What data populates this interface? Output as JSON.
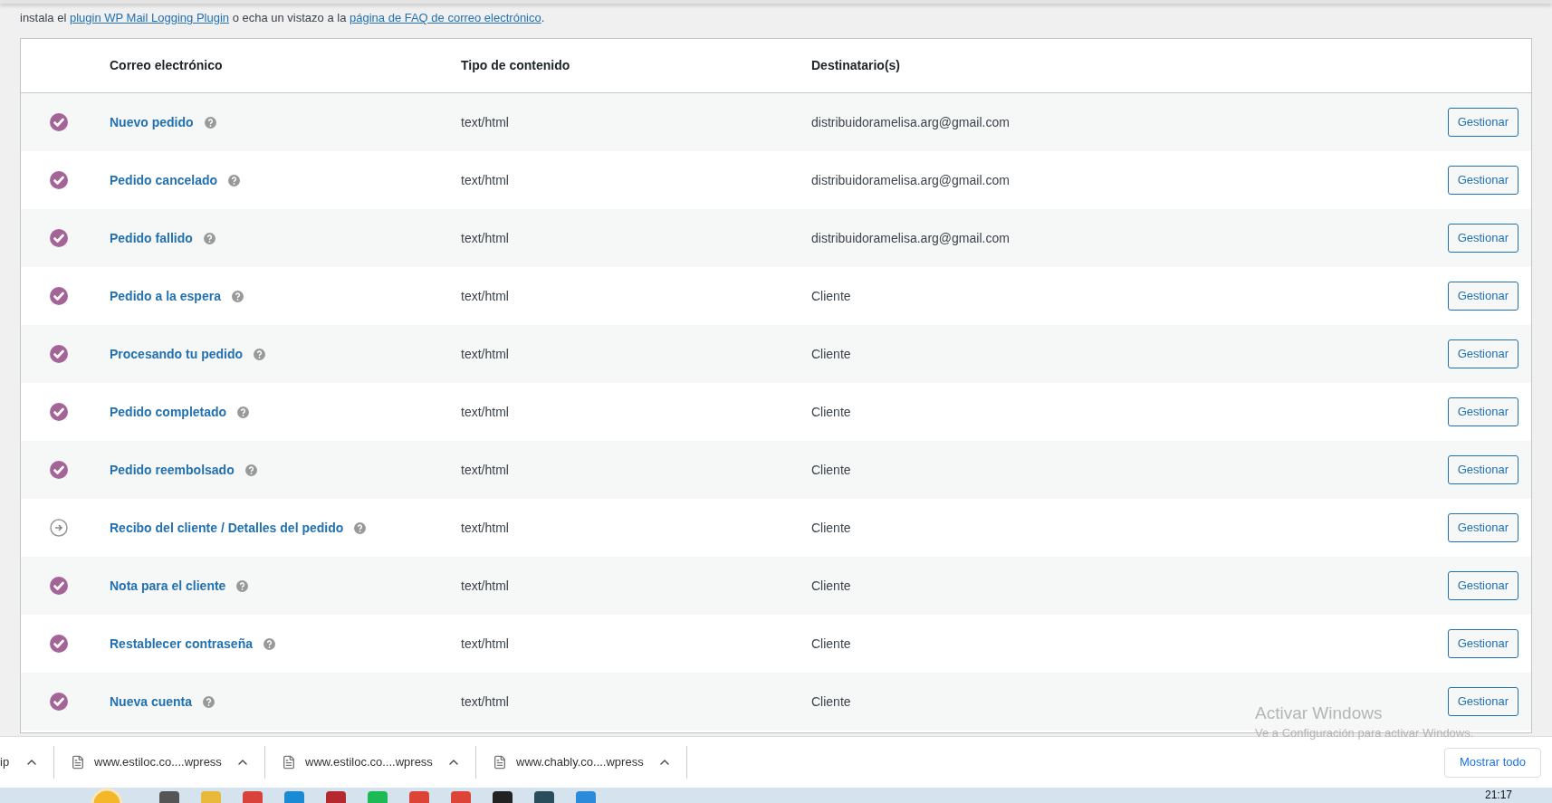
{
  "notice_parts": [
    {
      "kind": "text",
      "text": "instala el "
    },
    {
      "kind": "link",
      "text": "plugin WP Mail Logging Plugin"
    },
    {
      "kind": "text",
      "text": " o echa un vistazo a la "
    },
    {
      "kind": "link",
      "text": "página de FAQ de correo electrónico"
    },
    {
      "kind": "text",
      "text": "."
    }
  ],
  "table": {
    "columns": [
      "Correo electrónico",
      "Tipo de contenido",
      "Destinatario(s)"
    ],
    "rows": [
      {
        "enabled": true,
        "name": "Nuevo pedido",
        "type": "text/html",
        "recipient": "distribuidoramelisa.arg@gmail.com",
        "action": "Gestionar"
      },
      {
        "enabled": true,
        "name": "Pedido cancelado",
        "type": "text/html",
        "recipient": "distribuidoramelisa.arg@gmail.com",
        "action": "Gestionar"
      },
      {
        "enabled": true,
        "name": "Pedido fallido",
        "type": "text/html",
        "recipient": "distribuidoramelisa.arg@gmail.com",
        "action": "Gestionar"
      },
      {
        "enabled": true,
        "name": "Pedido a la espera",
        "type": "text/html",
        "recipient": "Cliente",
        "action": "Gestionar"
      },
      {
        "enabled": true,
        "name": "Procesando tu pedido",
        "type": "text/html",
        "recipient": "Cliente",
        "action": "Gestionar"
      },
      {
        "enabled": true,
        "name": "Pedido completado",
        "type": "text/html",
        "recipient": "Cliente",
        "action": "Gestionar"
      },
      {
        "enabled": true,
        "name": "Pedido reembolsado",
        "type": "text/html",
        "recipient": "Cliente",
        "action": "Gestionar"
      },
      {
        "enabled": false,
        "name": "Recibo del cliente / Detalles del pedido",
        "type": "text/html",
        "recipient": "Cliente",
        "action": "Gestionar"
      },
      {
        "enabled": true,
        "name": "Nota para el cliente",
        "type": "text/html",
        "recipient": "Cliente",
        "action": "Gestionar"
      },
      {
        "enabled": true,
        "name": "Restablecer contraseña",
        "type": "text/html",
        "recipient": "Cliente",
        "action": "Gestionar"
      },
      {
        "enabled": true,
        "name": "Nueva cuenta",
        "type": "text/html",
        "recipient": "Cliente",
        "action": "Gestionar"
      }
    ]
  },
  "activation_notice": {
    "title": "Activar Windows",
    "subtitle": "Ve a Configuración para activar Windows."
  },
  "downloads": {
    "items": [
      "ip",
      "www.estiloc.co....wpress",
      "www.estiloc.co....wpress",
      "www.chably.co....wpress"
    ],
    "show_all": "Mostrar todo"
  },
  "taskbar": {
    "clock": "21:17"
  }
}
